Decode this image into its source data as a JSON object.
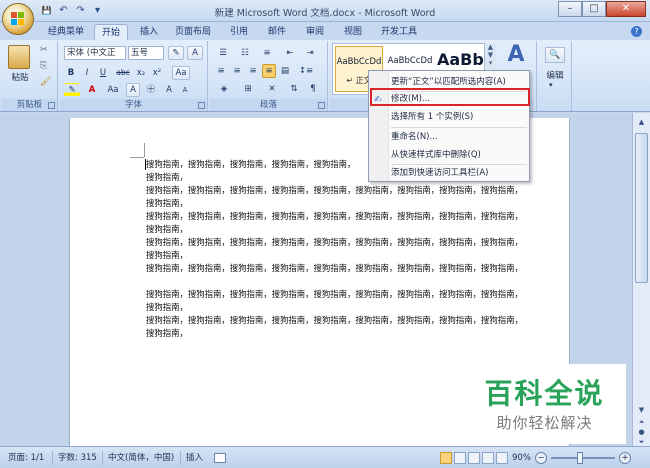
{
  "window": {
    "title": "新建 Microsoft Word 文档.docx - Microsoft Word",
    "minimize": "–",
    "maximize": "□",
    "close": "✕"
  },
  "qat": {
    "save": "💾",
    "undo": "↶",
    "redo": "↷",
    "customize": "▾"
  },
  "tabs": [
    {
      "label": "经典菜单"
    },
    {
      "label": "开始"
    },
    {
      "label": "插入"
    },
    {
      "label": "页面布局"
    },
    {
      "label": "引用"
    },
    {
      "label": "邮件"
    },
    {
      "label": "审阅"
    },
    {
      "label": "视图"
    },
    {
      "label": "开发工具"
    }
  ],
  "ribbon": {
    "clipboard": {
      "label": "剪贴板",
      "paste": "粘贴"
    },
    "font": {
      "label": "字体",
      "font_name": "宋体 (中文正",
      "font_size": "五号",
      "bold": "B",
      "italic": "I",
      "underline": "U",
      "strike": "abc",
      "subscript": "x₂",
      "superscript": "x²",
      "grow": "A",
      "shrink": "A"
    },
    "paragraph": {
      "label": "段落"
    },
    "styles": {
      "items": [
        {
          "preview": "AaBbCcDd",
          "name": "↵ 正文"
        },
        {
          "preview": "AaBbCcDd",
          "name": ""
        },
        {
          "preview": "AaBb",
          "name": ""
        }
      ],
      "change_styles": "A"
    },
    "editing": {
      "label": "编辑"
    }
  },
  "context_menu": {
    "items": [
      "更新“正文”以匹配所选内容(A)",
      "修改(M)...",
      "选择所有 1 个实例(S)",
      "重命名(N)...",
      "从快速样式库中删除(Q)",
      "添加到快速访问工具栏(A)"
    ]
  },
  "document": {
    "lines": [
      "搜狗指南，搜狗指南，搜狗指南，搜狗指南，搜狗指南，",
      "搜狗指南，",
      "搜狗指南，搜狗指南，搜狗指南，搜狗指南，搜狗指南，搜狗指南，搜狗指南，搜狗指南，搜狗指南，",
      "搜狗指南，",
      "搜狗指南，搜狗指南，搜狗指南，搜狗指南，搜狗指南，搜狗指南，搜狗指南，搜狗指南，搜狗指南，",
      "搜狗指南，",
      "搜狗指南，搜狗指南，搜狗指南，搜狗指南，搜狗指南，搜狗指南，搜狗指南，搜狗指南，搜狗指南，",
      "搜狗指南，",
      "搜狗指南，搜狗指南，搜狗指南，搜狗指南，搜狗指南，搜狗指南，搜狗指南，搜狗指南，搜狗指南，",
      "搜狗指南，搜狗指南，搜狗指南，搜狗指南，搜狗指南，搜狗指南，搜狗指南，搜狗指南，搜狗指南，",
      "搜狗指南，",
      "搜狗指南，搜狗指南，搜狗指南，搜狗指南，搜狗指南，搜狗指南，搜狗指南，搜狗指南，搜狗指南，",
      "搜狗指南，"
    ]
  },
  "statusbar": {
    "page": "页面: 1/1",
    "words": "字数: 315",
    "language": "中文(简体，中国)",
    "mode": "插入",
    "zoom": "90%",
    "zoom_out": "−",
    "zoom_in": "+"
  },
  "watermark": {
    "title": "百科全说",
    "subtitle": "助你轻松解决"
  },
  "colors": {
    "accent": "#2b579a",
    "highlight_box": "#d9252a",
    "watermark_green": "#2aa35a"
  }
}
